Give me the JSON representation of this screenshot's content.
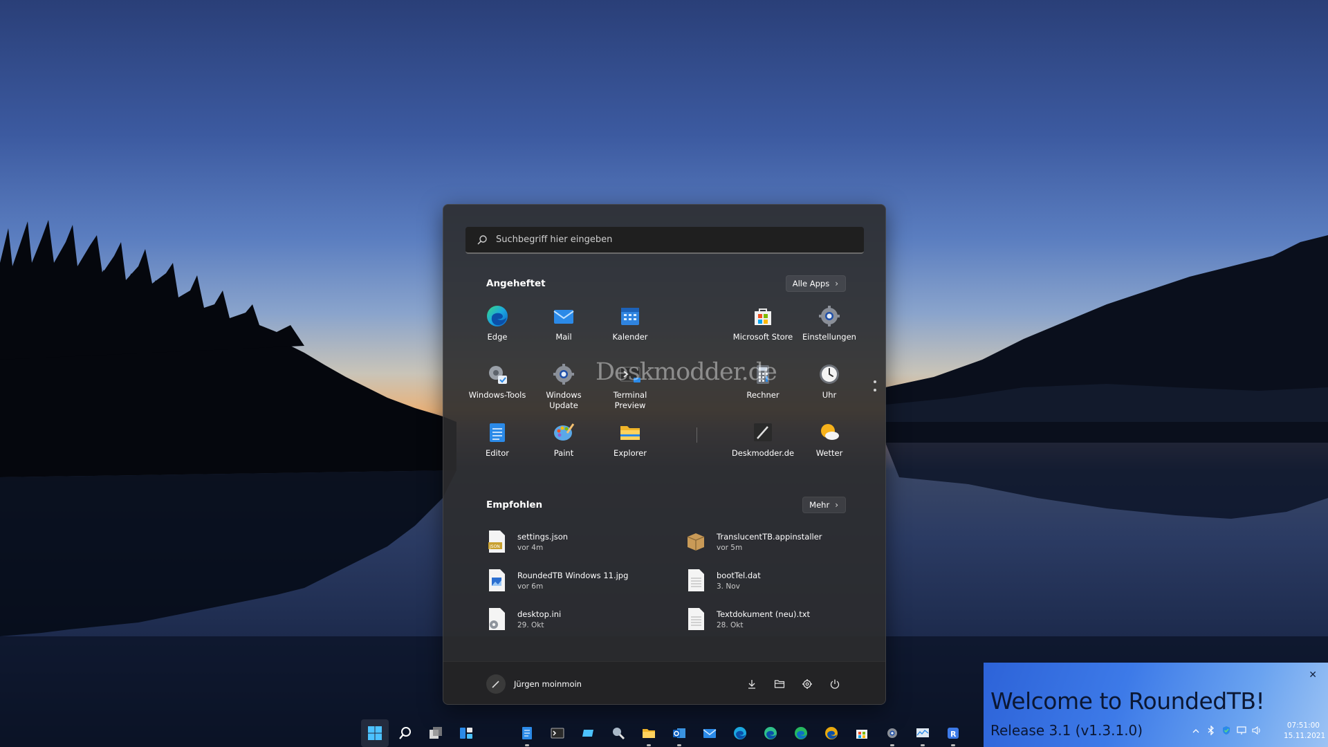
{
  "search": {
    "placeholder": "Suchbegriff hier eingeben"
  },
  "pinned": {
    "title": "Angeheftet",
    "all_apps_label": "Alle Apps",
    "apps": [
      {
        "label": "Edge",
        "icon": "edge-icon"
      },
      {
        "label": "Mail",
        "icon": "mail-icon"
      },
      {
        "label": "Kalender",
        "icon": "calendar-icon"
      },
      {
        "label": "Microsoft Store",
        "icon": "store-icon"
      },
      {
        "label": "Einstellungen",
        "icon": "settings-icon"
      },
      {
        "label": "Windows-Tools",
        "icon": "windows-tools-icon"
      },
      {
        "label": "Windows Update",
        "icon": "windows-update-icon"
      },
      {
        "label": "Terminal Preview",
        "icon": "terminal-icon"
      },
      {
        "label": "Rechner",
        "icon": "calculator-icon"
      },
      {
        "label": "Uhr",
        "icon": "clock-icon"
      },
      {
        "label": "Editor",
        "icon": "notepad-icon"
      },
      {
        "label": "Paint",
        "icon": "paint-icon"
      },
      {
        "label": "Explorer",
        "icon": "folder-icon"
      },
      {
        "label": "Deskmodder.de",
        "icon": "deskmodder-icon"
      },
      {
        "label": "Wetter",
        "icon": "weather-icon"
      }
    ]
  },
  "watermark": "Deskmodder.de",
  "recommended": {
    "title": "Empfohlen",
    "more_label": "Mehr",
    "items": [
      {
        "name": "settings.json",
        "time": "vor 4m",
        "icon": "json-file-icon"
      },
      {
        "name": "TranslucentTB.appinstaller",
        "time": "vor 5m",
        "icon": "package-icon"
      },
      {
        "name": "RoundedTB Windows 11.jpg",
        "time": "vor 6m",
        "icon": "image-file-icon"
      },
      {
        "name": "bootTel.dat",
        "time": "3. Nov",
        "icon": "file-icon"
      },
      {
        "name": "desktop.ini",
        "time": "29. Okt",
        "icon": "ini-file-icon"
      },
      {
        "name": "Textdokument (neu).txt",
        "time": "28. Okt",
        "icon": "text-file-icon"
      }
    ]
  },
  "user": {
    "name": "Jürgen moinmoin"
  },
  "toast": {
    "title": "Welcome to RoundedTB!",
    "subtitle": "Release 3.1 (v1.3.1.0)"
  },
  "clock": {
    "time": "07:51:00",
    "date": "15.11.2021"
  },
  "colors": {
    "accent": "#3c8ee8",
    "menu_bg": "#2c2c2e",
    "toast_bg": "#3d7ae8"
  }
}
